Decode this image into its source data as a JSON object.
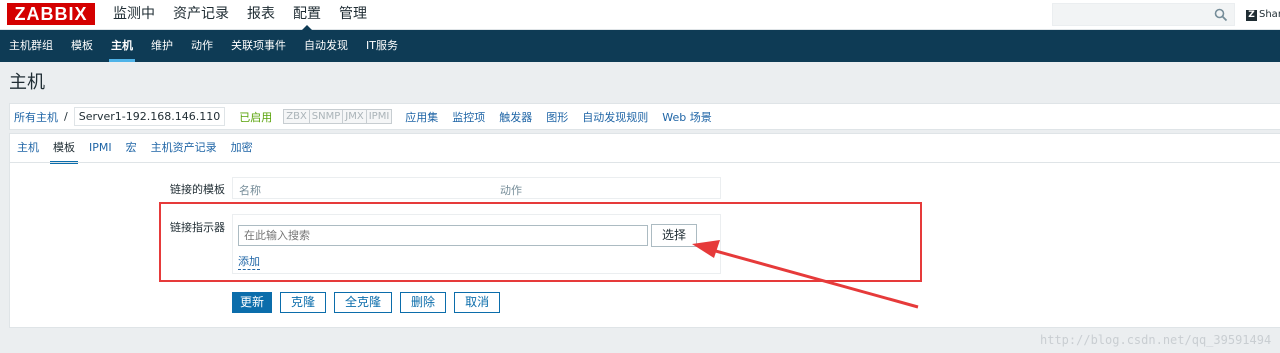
{
  "header": {
    "logo": "ZABBIX",
    "menu": [
      "监测中",
      "资产记录",
      "报表",
      "配置",
      "管理"
    ],
    "active_menu": "配置",
    "share_label": "Shar",
    "share_badge": "Z"
  },
  "submenu": {
    "items": [
      "主机群组",
      "模板",
      "主机",
      "维护",
      "动作",
      "关联项事件",
      "自动发现",
      "IT服务"
    ],
    "active": "主机"
  },
  "page": {
    "title": "主机"
  },
  "breadcrumb": {
    "all_hosts": "所有主机",
    "separator": "/",
    "current_host": "Server1-192.168.146.110",
    "status": "已启用",
    "availability": [
      "ZBX",
      "SNMP",
      "JMX",
      "IPMI"
    ],
    "nav": [
      "应用集",
      "监控项",
      "触发器",
      "图形",
      "自动发现规则",
      "Web 场景"
    ]
  },
  "tabs": {
    "items": [
      "主机",
      "模板",
      "IPMI",
      "宏",
      "主机资产记录",
      "加密"
    ],
    "active": "模板"
  },
  "form": {
    "linked_templates_label": "链接的模板",
    "col_name": "名称",
    "col_action": "动作",
    "link_indicator_label": "链接指示器",
    "search_placeholder": "在此输入搜索",
    "select_button": "选择",
    "add_link": "添加"
  },
  "buttons": {
    "update": "更新",
    "clone": "克隆",
    "full_clone": "全克隆",
    "delete": "删除",
    "cancel": "取消"
  },
  "watermark": "http://blog.csdn.net/qq_39591494",
  "colors": {
    "brand": "#d40000",
    "nav_bg": "#0e3b55",
    "link": "#1f65a6",
    "primary": "#0b6dab",
    "enabled": "#59a30a",
    "annotation": "#e63a3a"
  }
}
